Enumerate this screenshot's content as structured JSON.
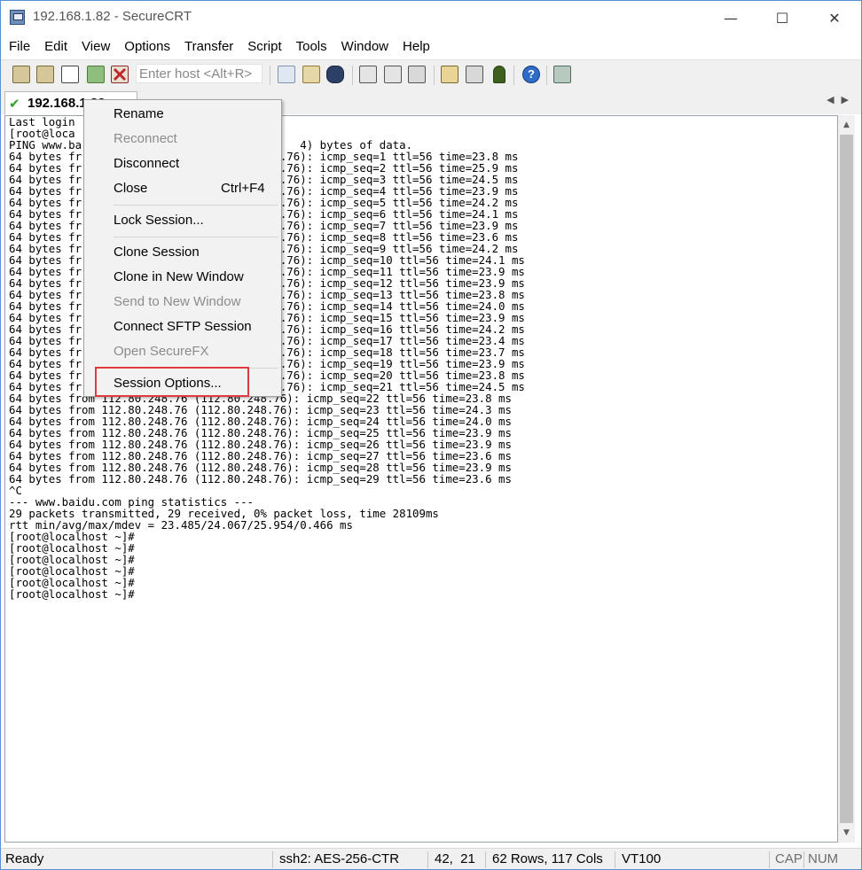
{
  "window": {
    "title": "192.168.1.82 - SecureCRT",
    "minimize_glyph": "—",
    "maximize_glyph": "☐",
    "close_glyph": "✕"
  },
  "menubar": [
    "File",
    "Edit",
    "View",
    "Options",
    "Transfer",
    "Script",
    "Tools",
    "Window",
    "Help"
  ],
  "toolbar": {
    "host_placeholder": "Enter host <Alt+R>",
    "icons": [
      "connect-icon",
      "quick-connect-icon",
      "connect-in-tab-icon",
      "reconnect-icon",
      "disconnect-icon",
      "copy-icon",
      "paste-icon",
      "find-icon",
      "print-screen-icon",
      "print-selection-icon",
      "print-icon",
      "session-options-icon",
      "global-options-icon",
      "keymap-icon",
      "help-icon",
      "sftp-icon"
    ]
  },
  "tab": {
    "label": "192.168.1.82",
    "check_glyph": "✔",
    "arrows": "◀▶"
  },
  "terminal": {
    "lines": [
      "Last login",
      "[root@loca",
      "PING www.ba                                 4) bytes of data.",
      "64 bytes fr                              .76): icmp_seq=1 ttl=56 time=23.8 ms",
      "64 bytes fr                              .76): icmp_seq=2 ttl=56 time=25.9 ms",
      "64 bytes fr                              .76): icmp_seq=3 ttl=56 time=24.5 ms",
      "64 bytes fr                              .76): icmp_seq=4 ttl=56 time=23.9 ms",
      "64 bytes fr                              .76): icmp_seq=5 ttl=56 time=24.2 ms",
      "64 bytes fr                              .76): icmp_seq=6 ttl=56 time=24.1 ms",
      "64 bytes fr                              .76): icmp_seq=7 ttl=56 time=23.9 ms",
      "64 bytes fr                              .76): icmp_seq=8 ttl=56 time=23.6 ms",
      "64 bytes fr                              .76): icmp_seq=9 ttl=56 time=24.2 ms",
      "64 bytes fr                              .76): icmp_seq=10 ttl=56 time=24.1 ms",
      "64 bytes fr                              .76): icmp_seq=11 ttl=56 time=23.9 ms",
      "64 bytes fr                              .76): icmp_seq=12 ttl=56 time=23.9 ms",
      "64 bytes fr                              .76): icmp_seq=13 ttl=56 time=23.8 ms",
      "64 bytes fr                              .76): icmp_seq=14 ttl=56 time=24.0 ms",
      "64 bytes fr                              .76): icmp_seq=15 ttl=56 time=23.9 ms",
      "64 bytes fr                              .76): icmp_seq=16 ttl=56 time=24.2 ms",
      "64 bytes fr                              .76): icmp_seq=17 ttl=56 time=23.4 ms",
      "64 bytes fr                              .76): icmp_seq=18 ttl=56 time=23.7 ms",
      "64 bytes fr                              .76): icmp_seq=19 ttl=56 time=23.9 ms",
      "64 bytes fr                              .76): icmp_seq=20 ttl=56 time=23.8 ms",
      "64 bytes fr                              .76): icmp_seq=21 ttl=56 time=24.5 ms",
      "64 bytes from 112.80.248.76 (112.80.248.76): icmp_seq=22 ttl=56 time=23.8 ms",
      "64 bytes from 112.80.248.76 (112.80.248.76): icmp_seq=23 ttl=56 time=24.3 ms",
      "64 bytes from 112.80.248.76 (112.80.248.76): icmp_seq=24 ttl=56 time=24.0 ms",
      "64 bytes from 112.80.248.76 (112.80.248.76): icmp_seq=25 ttl=56 time=23.9 ms",
      "64 bytes from 112.80.248.76 (112.80.248.76): icmp_seq=26 ttl=56 time=23.9 ms",
      "64 bytes from 112.80.248.76 (112.80.248.76): icmp_seq=27 ttl=56 time=23.6 ms",
      "64 bytes from 112.80.248.76 (112.80.248.76): icmp_seq=28 ttl=56 time=23.9 ms",
      "64 bytes from 112.80.248.76 (112.80.248.76): icmp_seq=29 ttl=56 time=23.6 ms",
      "^C",
      "--- www.baidu.com ping statistics ---",
      "29 packets transmitted, 29 received, 0% packet loss, time 28109ms",
      "rtt min/avg/max/mdev = 23.485/24.067/25.954/0.466 ms",
      "[root@localhost ~]#",
      "[root@localhost ~]#",
      "[root@localhost ~]#",
      "[root@localhost ~]#",
      "[root@localhost ~]#",
      "[root@localhost ~]#"
    ]
  },
  "scrollbar": {
    "up_glyph": "▲",
    "down_glyph": "▼"
  },
  "context_menu": {
    "rename": "Rename",
    "reconnect": "Reconnect",
    "disconnect": "Disconnect",
    "close": "Close",
    "close_shortcut": "Ctrl+F4",
    "lock_session": "Lock Session...",
    "clone_session": "Clone Session",
    "clone_new_window": "Clone in New Window",
    "send_new_window": "Send to New Window",
    "connect_sftp": "Connect SFTP Session",
    "open_securefx": "Open SecureFX",
    "session_options": "Session Options..."
  },
  "statusbar": {
    "ready": "Ready",
    "encryption": "ssh2: AES-256-CTR",
    "cursor_pos": "42,  21",
    "size": "62 Rows, 117 Cols",
    "terminal_type": "VT100",
    "cap": "CAP",
    "num": "NUM"
  },
  "colors": {
    "highlight_box": "#e0393e",
    "window_border": "#5a8fd3",
    "connected_check": "#34a02b"
  }
}
